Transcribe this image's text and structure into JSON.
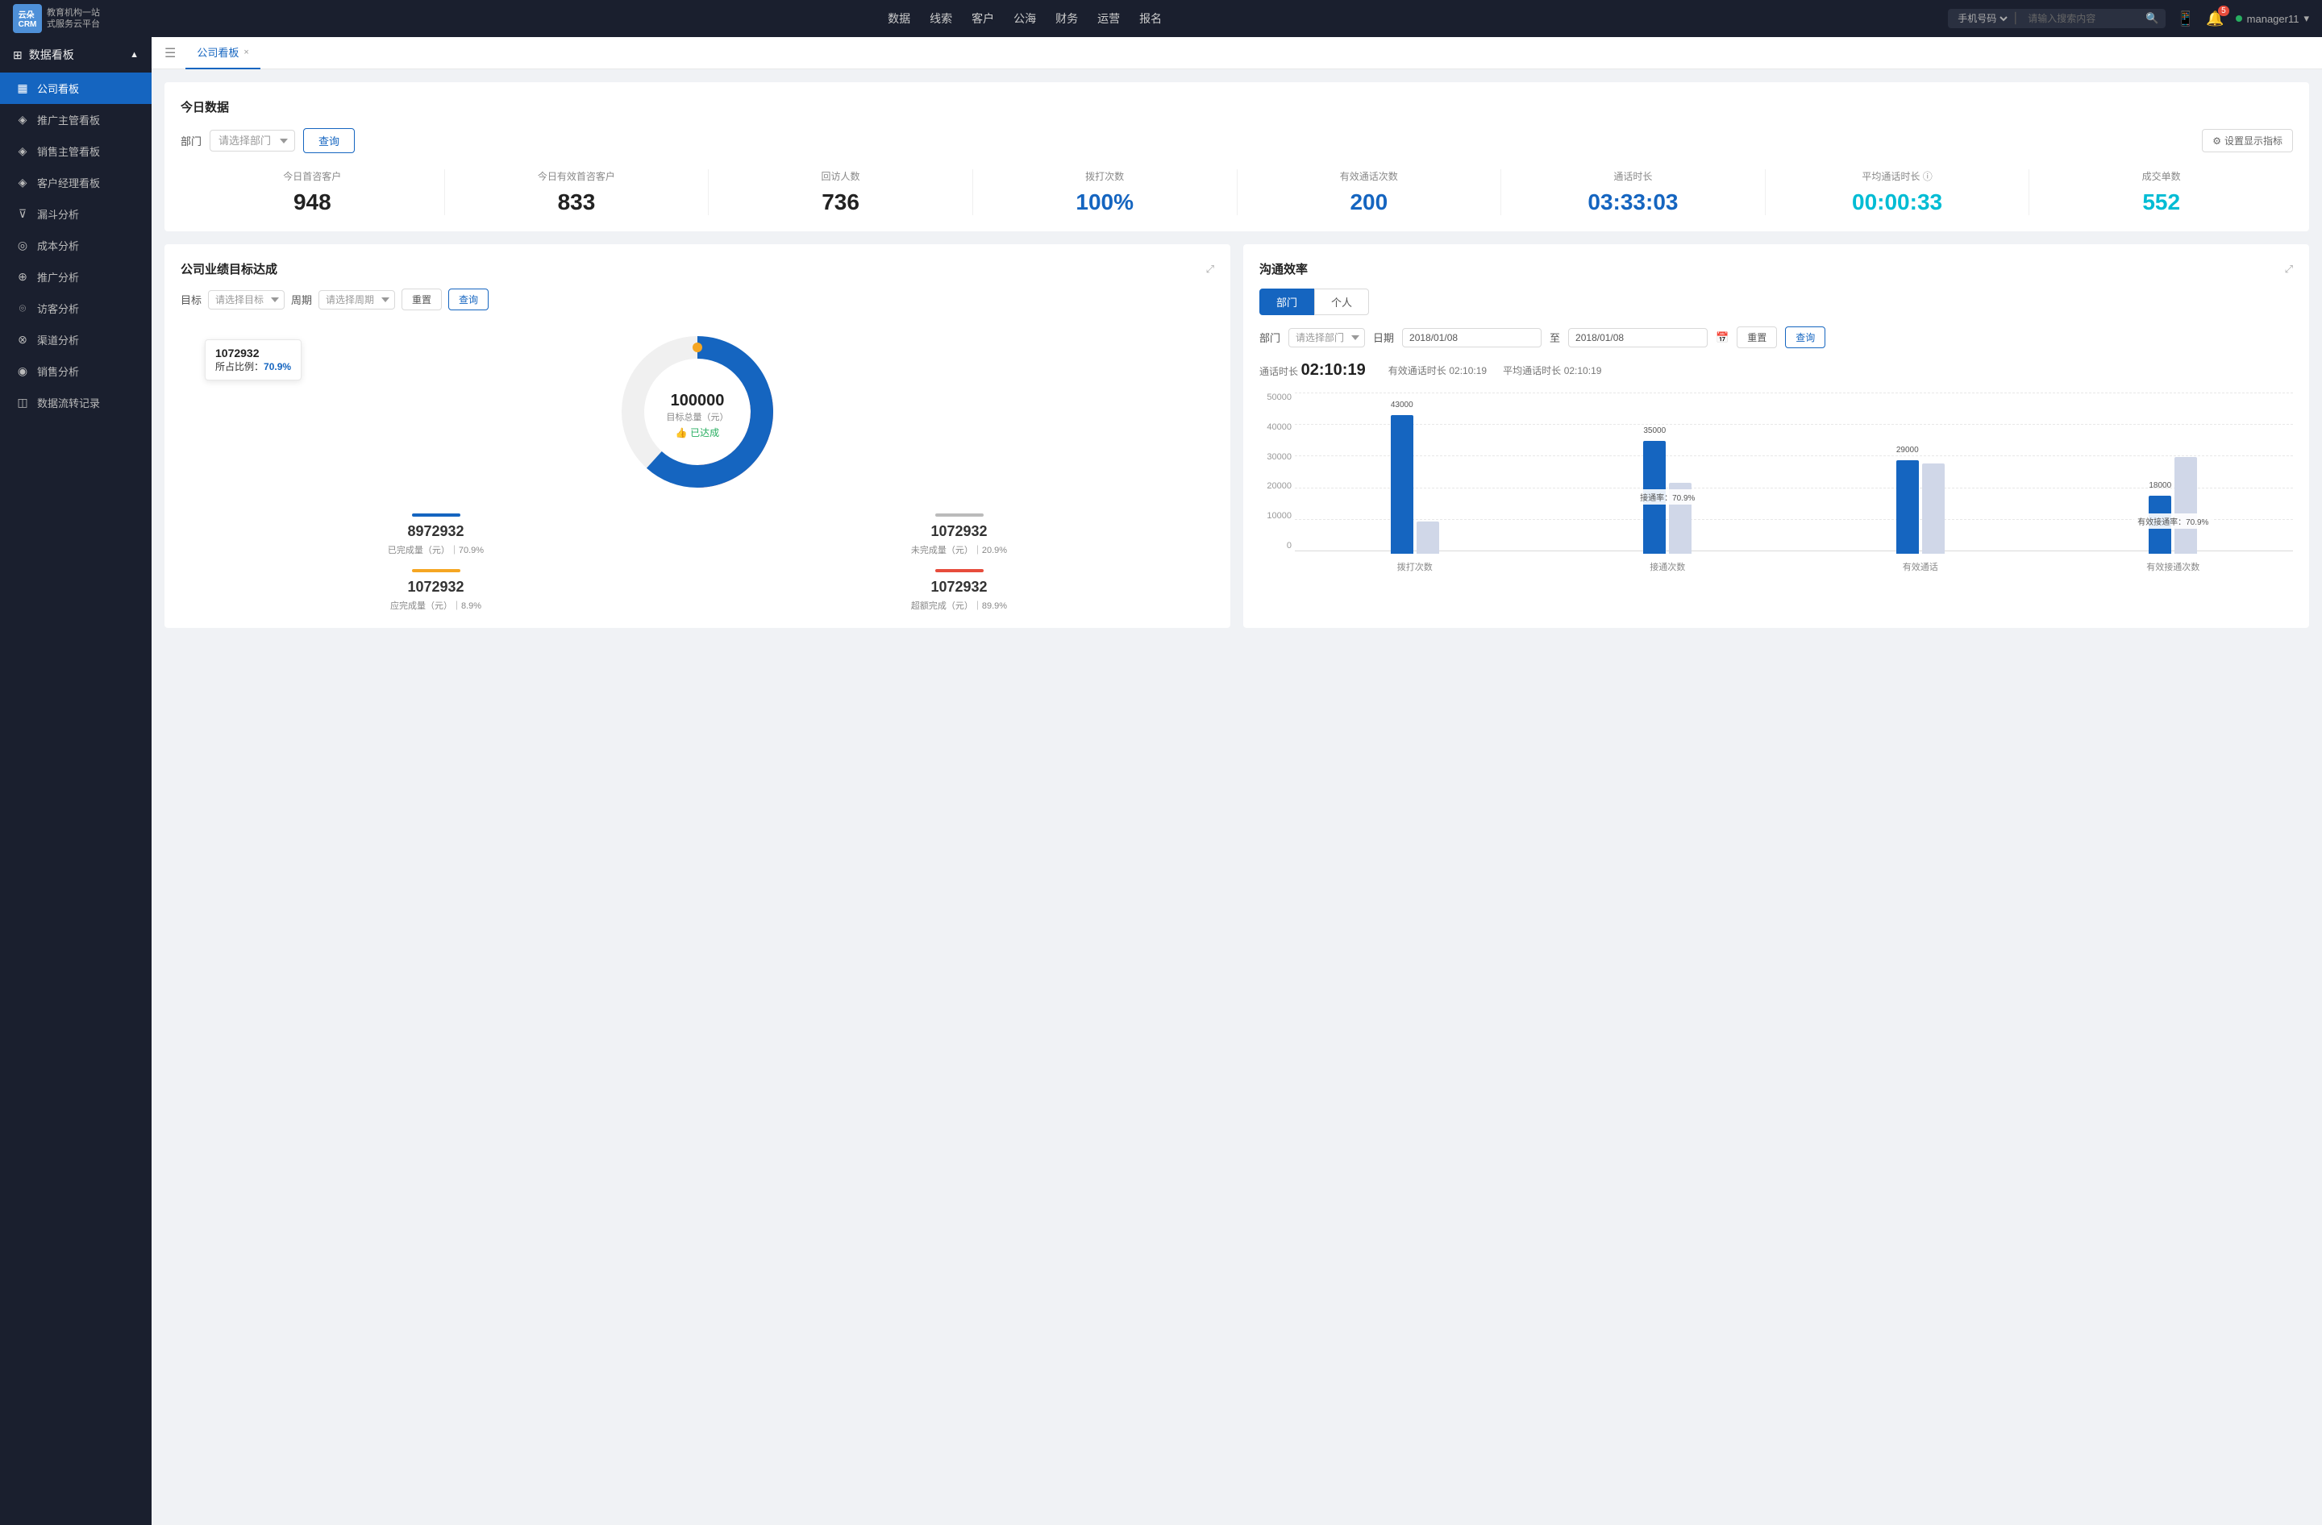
{
  "topNav": {
    "links": [
      "数据",
      "线索",
      "客户",
      "公海",
      "财务",
      "运营",
      "报名"
    ],
    "searchPlaceholder": "请输入搜索内容",
    "searchSelect": "手机号码",
    "user": "manager11",
    "notificationCount": "5"
  },
  "sidebar": {
    "sectionTitle": "数据看板",
    "items": [
      {
        "label": "公司看板",
        "icon": "▦",
        "active": true
      },
      {
        "label": "推广主管看板",
        "icon": "◈",
        "active": false
      },
      {
        "label": "销售主管看板",
        "icon": "◈",
        "active": false
      },
      {
        "label": "客户经理看板",
        "icon": "◈",
        "active": false
      },
      {
        "label": "漏斗分析",
        "icon": "⊽",
        "active": false
      },
      {
        "label": "成本分析",
        "icon": "◎",
        "active": false
      },
      {
        "label": "推广分析",
        "icon": "⊕",
        "active": false
      },
      {
        "label": "访客分析",
        "icon": "⌾",
        "active": false
      },
      {
        "label": "渠道分析",
        "icon": "⊗",
        "active": false
      },
      {
        "label": "销售分析",
        "icon": "◉",
        "active": false
      },
      {
        "label": "数据流转记录",
        "icon": "◫",
        "active": false
      }
    ]
  },
  "tab": {
    "label": "公司看板",
    "closeLabel": "×"
  },
  "todaySection": {
    "title": "今日数据",
    "filterLabel": "部门",
    "filterPlaceholder": "请选择部门",
    "queryBtn": "查询",
    "settingsBtn": "设置显示指标",
    "stats": [
      {
        "label": "今日首咨客户",
        "value": "948",
        "color": "black"
      },
      {
        "label": "今日有效首咨客户",
        "value": "833",
        "color": "black"
      },
      {
        "label": "回访人数",
        "value": "736",
        "color": "black"
      },
      {
        "label": "拨打次数",
        "value": "100%",
        "color": "blue"
      },
      {
        "label": "有效通话次数",
        "value": "200",
        "color": "blue"
      },
      {
        "label": "通话时长",
        "value": "03:33:03",
        "color": "blue"
      },
      {
        "label": "平均通话时长",
        "value": "00:00:33",
        "color": "cyan"
      },
      {
        "label": "成交单数",
        "value": "552",
        "color": "cyan"
      }
    ]
  },
  "targetPanel": {
    "title": "公司业绩目标达成",
    "targetLabel": "目标",
    "targetPlaceholder": "请选择目标",
    "periodLabel": "周期",
    "periodPlaceholder": "请选择周期",
    "resetBtn": "重置",
    "queryBtn": "查询",
    "donut": {
      "centerValue": "100000",
      "centerSub": "目标总量（元）",
      "achieved": "👍 已达成",
      "tooltip": {
        "value": "1072932",
        "label": "所占比例：",
        "pct": "70.9%"
      }
    },
    "stats": [
      {
        "label": "已完成量（元）｜70.9%",
        "value": "8972932",
        "color": "#1565c0"
      },
      {
        "label": "未完成量（元）｜20.9%",
        "value": "1072932",
        "color": "#bbb"
      },
      {
        "label": "应完成量（元）｜8.9%",
        "value": "1072932",
        "color": "#f5a623"
      },
      {
        "label": "超额完成（元）｜89.9%",
        "value": "1072932",
        "color": "#e74c3c"
      }
    ]
  },
  "effPanel": {
    "title": "沟通效率",
    "tabs": [
      "部门",
      "个人"
    ],
    "activeTab": 0,
    "filterLabel": "部门",
    "filterPlaceholder": "请选择部门",
    "dateLabel": "日期",
    "dateFrom": "2018/01/08",
    "dateTo": "2018/01/08",
    "resetBtn": "重置",
    "queryBtn": "查询",
    "stats": {
      "talkTime": "02:10:19",
      "talkTimeLabel": "通话时长",
      "effTalkTime": "02:10:19",
      "effTalkTimeLabel": "有效通话时长",
      "avgTalkTime": "02:10:19",
      "avgTalkTimeLabel": "平均通话时长"
    },
    "chart": {
      "yLabels": [
        "50000",
        "40000",
        "30000",
        "20000",
        "10000",
        "0"
      ],
      "groups": [
        {
          "xLabel": "拨打次数",
          "bars": [
            {
              "value": 43000,
              "label": "43000",
              "color": "#1565c0",
              "heightPct": 86
            },
            {
              "value": 10000,
              "label": "",
              "color": "#d0d7e8",
              "heightPct": 20
            }
          ],
          "annotation": null
        },
        {
          "xLabel": "接通次数",
          "bars": [
            {
              "value": 35000,
              "label": "35000",
              "color": "#1565c0",
              "heightPct": 70
            },
            {
              "value": 22000,
              "label": "",
              "color": "#d0d7e8",
              "heightPct": 44
            }
          ],
          "annotation": "接通率：70.9%"
        },
        {
          "xLabel": "有效通话",
          "bars": [
            {
              "value": 29000,
              "label": "29000",
              "color": "#1565c0",
              "heightPct": 58
            },
            {
              "value": 28000,
              "label": "",
              "color": "#d0d7e8",
              "heightPct": 56
            }
          ],
          "annotation": null
        },
        {
          "xLabel": "有效接通次数",
          "bars": [
            {
              "value": 18000,
              "label": "18000",
              "color": "#1565c0",
              "heightPct": 36
            },
            {
              "value": 30000,
              "label": "",
              "color": "#d0d7e8",
              "heightPct": 60
            }
          ],
          "annotation": "有效接通率：70.9%"
        }
      ]
    }
  }
}
